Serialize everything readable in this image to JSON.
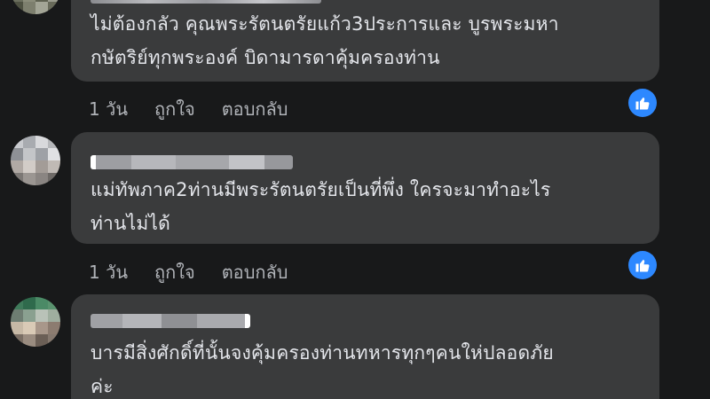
{
  "comments": [
    {
      "text": "ไม่ต้องกลัว คุณพระรัตนตรัยแก้ว3ประการและ บูรพระมหา\nกษัตริย์ทุกพระองค์ บิดามารดาคุ้มครองท่าน",
      "time": "1 วัน",
      "like_label": "ถูกใจ",
      "reply_label": "ตอบกลับ",
      "reaction": "like-icon"
    },
    {
      "text": "แม่ทัพภาค2ท่านมีพระรัตนตรัยเป็นที่พึ่ง ใครจะมาทำอะไร\nท่านไม่ได้",
      "time": "1 วัน",
      "like_label": "ถูกใจ",
      "reply_label": "ตอบกลับ",
      "reaction": "like-icon"
    },
    {
      "text": "บารมีสิ่งศักดิ์ที่นั้นจงคุ้มครองท่านทหารทุกๆคนให่ปลอดภัย\nค่ะ"
    }
  ],
  "colors": {
    "background": "#18191a",
    "bubble": "#3a3b3c",
    "text": "#e4e6eb",
    "meta": "#b0b3b8",
    "like": "#2d88ff"
  }
}
